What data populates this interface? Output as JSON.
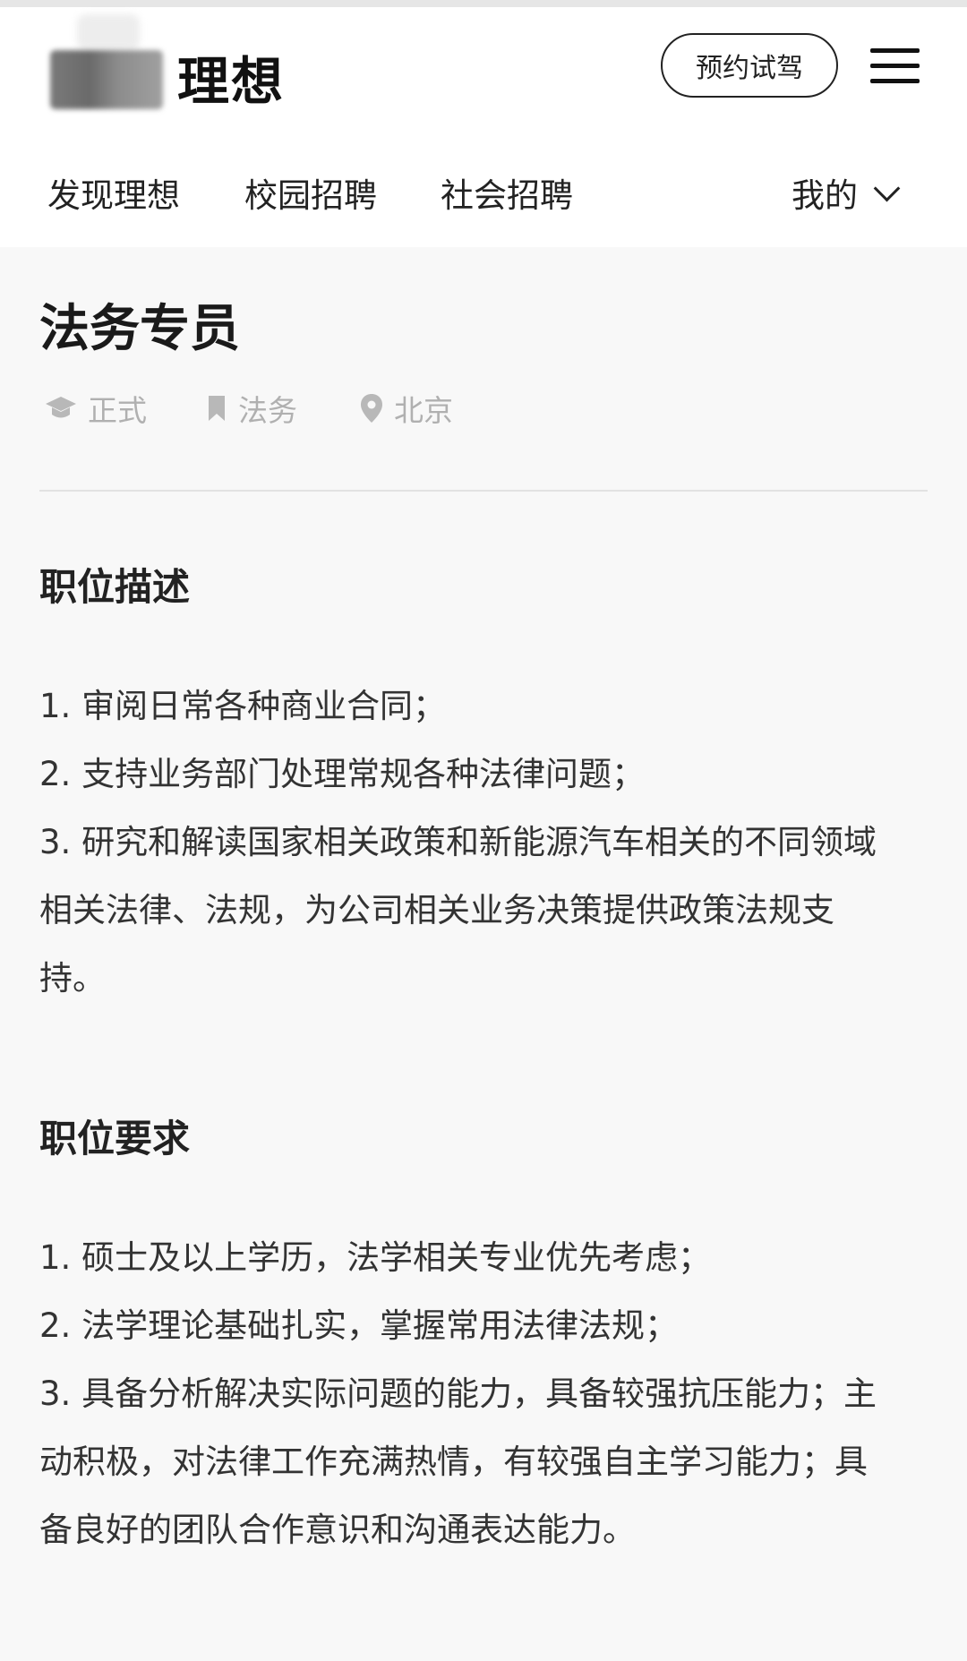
{
  "header": {
    "brand": "理想",
    "book_button": "预约试驾",
    "nav": [
      "发现理想",
      "校园招聘",
      "社会招聘"
    ],
    "mine": "我的"
  },
  "job": {
    "title": "法务专员",
    "tags": {
      "type": "正式",
      "category": "法务",
      "location": "北京"
    },
    "description_heading": "职位描述",
    "description_lines": [
      "1. 审阅日常各种商业合同；",
      "2. 支持业务部门处理常规各种法律问题；",
      "3. 研究和解读国家相关政策和新能源汽车相关的不同领域",
      "相关法律、法规，为公司相关业务决策提供政策法规支",
      "持。"
    ],
    "requirements_heading": "职位要求",
    "requirements_lines": [
      "1. 硕士及以上学历，法学相关专业优先考虑；",
      "2. 法学理论基础扎实，掌握常用法律法规；",
      "3. 具备分析解决实际问题的能力，具备较强抗压能力；主",
      "动积极，对法律工作充满热情，有较强自主学习能力；具",
      "备良好的团队合作意识和沟通表达能力。"
    ]
  },
  "icons": {
    "tag_type": "graduation-cap-icon",
    "tag_category": "bookmark-icon",
    "tag_location": "location-pin-icon",
    "menu": "hamburger-menu-icon",
    "mine_dropdown": "chevron-down-icon"
  }
}
